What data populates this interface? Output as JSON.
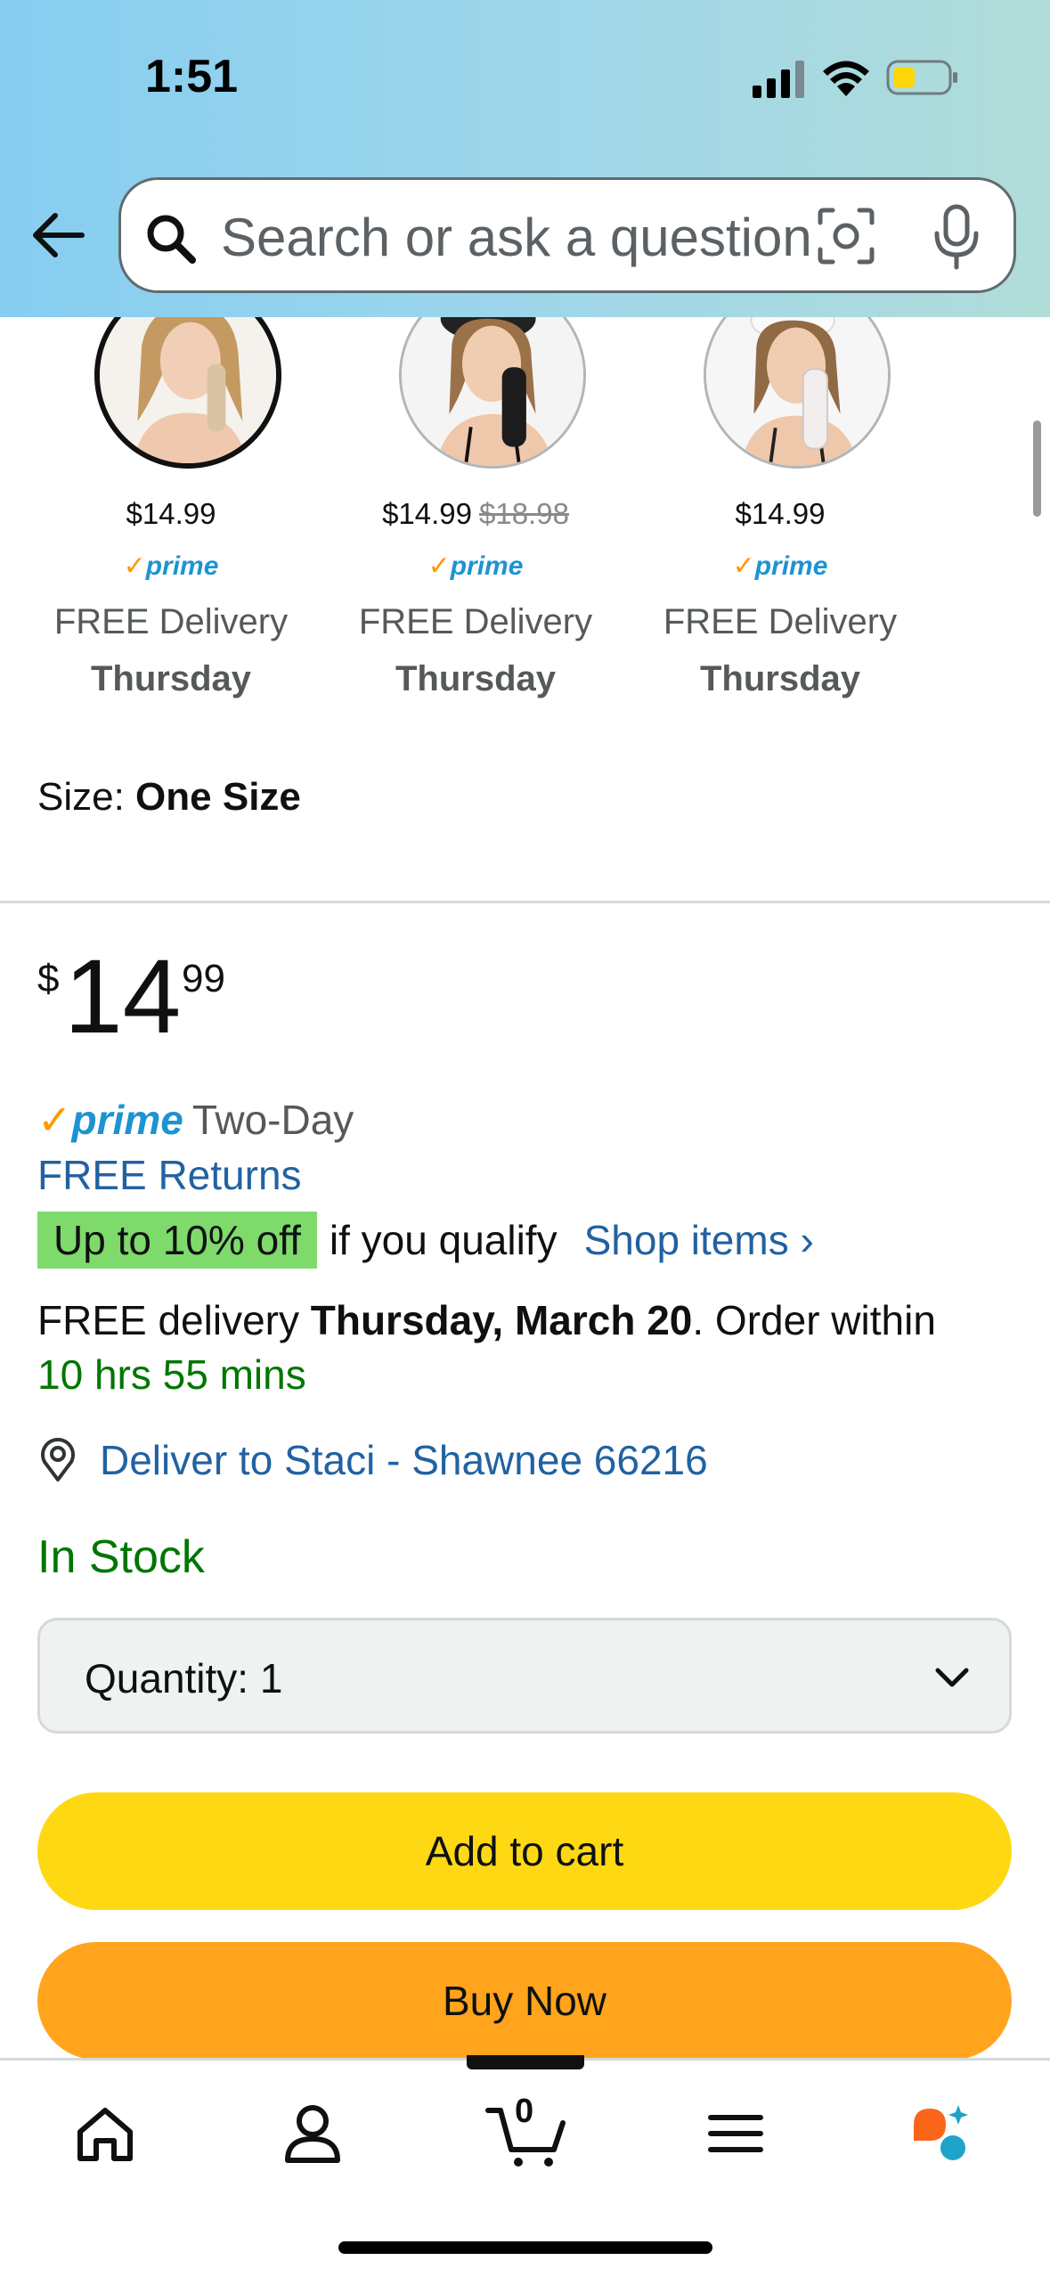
{
  "status_bar": {
    "time": "1:51"
  },
  "search": {
    "placeholder": "Search or ask a question"
  },
  "variations": [
    {
      "price": "$14.99",
      "old_price": "",
      "prime": "prime",
      "delivery": "FREE Delivery",
      "day": "Thursday",
      "glove_color": "#d9c3a3",
      "selected": true
    },
    {
      "price": "$14.99",
      "old_price": "$18.98",
      "prime": "prime",
      "delivery": "FREE Delivery",
      "day": "Thursday",
      "glove_color": "#1c1c1c",
      "selected": false
    },
    {
      "price": "$14.99",
      "old_price": "",
      "prime": "prime",
      "delivery": "FREE Delivery",
      "day": "Thursday",
      "glove_color": "#f2eeee",
      "selected": false
    }
  ],
  "size": {
    "label": "Size: ",
    "value": "One Size"
  },
  "price": {
    "currency": "$",
    "whole": "14",
    "fraction": "99"
  },
  "prime_shipping": {
    "brand": "prime",
    "label": "Two-Day"
  },
  "free_returns": "FREE Returns",
  "promo": {
    "badge": "Up to 10% off",
    "text": "if you qualify",
    "link": "Shop items ›"
  },
  "delivery": {
    "prefix": "FREE delivery ",
    "date": "Thursday, March 20",
    "suffix": ". Order within",
    "countdown": "10 hrs 55 mins"
  },
  "location": "Deliver to Staci - Shawnee 66216",
  "stock": "In Stock",
  "quantity": {
    "label": "Quantity:",
    "value": "1"
  },
  "buttons": {
    "add_to_cart": "Add to cart",
    "buy_now": "Buy Now"
  },
  "nav": {
    "cart_count": "0"
  },
  "colors": {
    "accent_link": "#2162a1",
    "in_stock": "#007600",
    "cart_button": "#ffd814",
    "buy_button": "#ffa41c",
    "promo_badge": "#7fda6c",
    "prime_check": "#ff9900",
    "prime_word": "#1e93d1"
  },
  "icons": [
    "back-arrow-icon",
    "search-icon",
    "camera-lens-icon",
    "microphone-icon",
    "location-pin-icon",
    "chevron-down-icon",
    "home-icon",
    "account-icon",
    "cart-icon",
    "menu-icon",
    "rufus-assistant-icon"
  ]
}
